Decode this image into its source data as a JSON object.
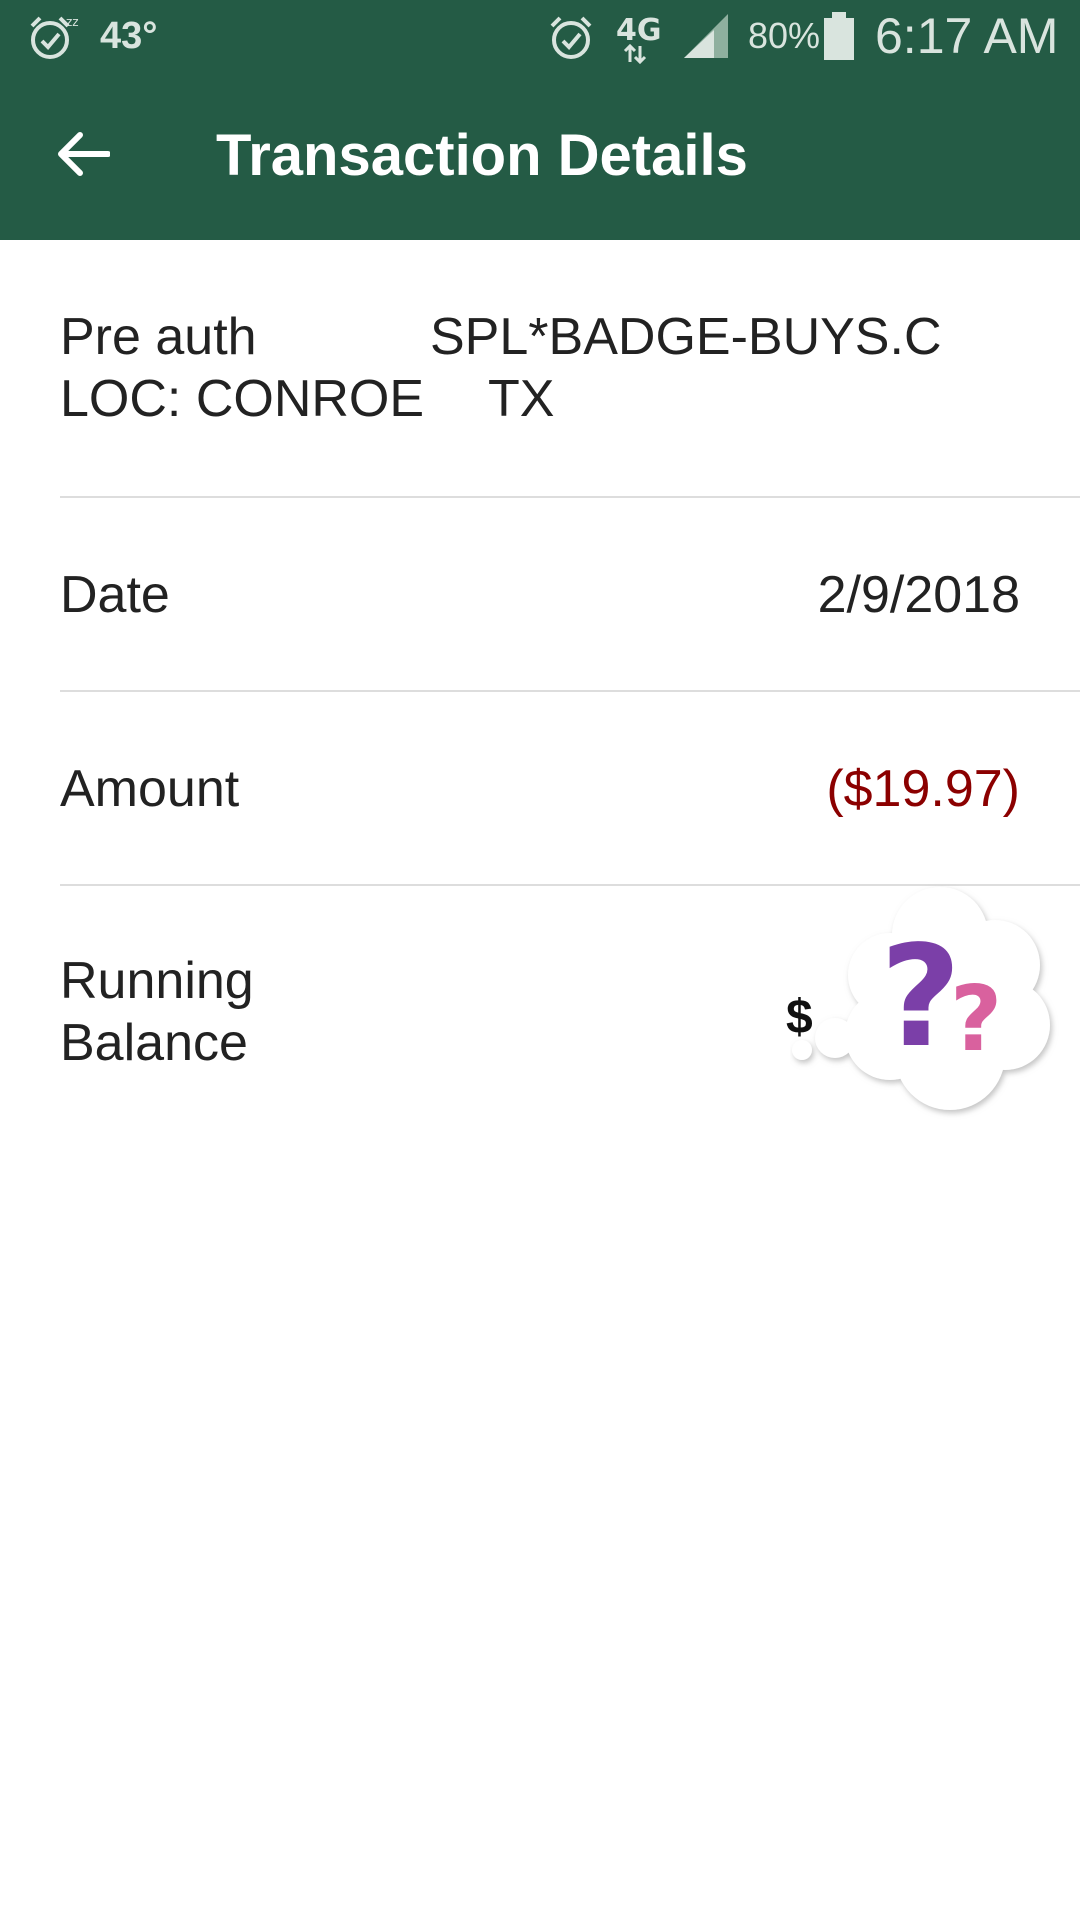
{
  "status_bar": {
    "temperature": "43°",
    "network": "4G",
    "battery": "80%",
    "time": "6:17 AM",
    "icons": [
      "snooze-alarm-icon",
      "alarm-icon",
      "lte-data-icon",
      "signal-icon",
      "battery-icon"
    ]
  },
  "app_bar": {
    "title": "Transaction Details",
    "back_icon": "arrow-back-icon"
  },
  "transaction": {
    "description_line1_left": "Pre auth",
    "description_line1_right": "SPL*BADGE-BUYS.C",
    "description_line2_left": "LOC: CONROE",
    "description_line2_right": "TX",
    "date_label": "Date",
    "date_value": "2/9/2018",
    "amount_label": "Amount",
    "amount_value": "($19.97)",
    "balance_label_line1": "Running",
    "balance_label_line2": "Balance",
    "balance_value_visible": "$"
  },
  "colors": {
    "primary": "#245b45",
    "negative_amount": "#8b0000",
    "divider": "#dddddd"
  }
}
